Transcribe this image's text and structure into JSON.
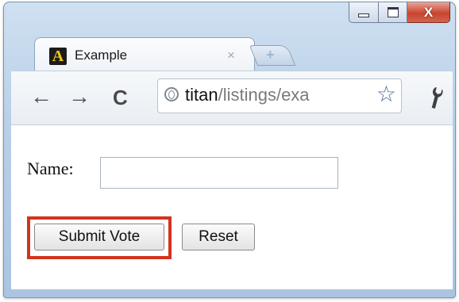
{
  "window": {
    "controls": {
      "minimize_icon": "minimize-icon",
      "maximize_icon": "maximize-icon",
      "close_glyph": "X"
    }
  },
  "tab": {
    "favicon_letter": "A",
    "title": "Example",
    "close_glyph": "×",
    "new_tab_glyph": "+"
  },
  "toolbar": {
    "back_glyph": "←",
    "forward_glyph": "→",
    "reload_glyph": "C",
    "url_host": "titan",
    "url_path": "/listings/exa",
    "star_glyph": "☆",
    "wrench_glyph": "🔧"
  },
  "form": {
    "name_label": "Name:",
    "name_value": "",
    "submit_label": "Submit Vote",
    "reset_label": "Reset"
  },
  "colors": {
    "highlight": "#d4331e",
    "close_button": "#c8452f"
  }
}
